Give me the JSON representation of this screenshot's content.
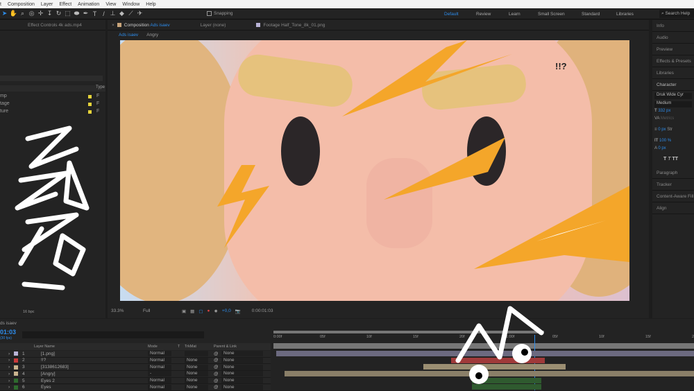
{
  "menu": [
    "t",
    "Composition",
    "Layer",
    "Effect",
    "Animation",
    "View",
    "Window",
    "Help"
  ],
  "toolbar": {
    "snapping": "Snapping"
  },
  "workspaces": [
    "Default",
    "Review",
    "Learn",
    "Small Screen",
    "Standard",
    "Libraries"
  ],
  "search_help": "Search Help",
  "left_panel": {
    "tab": "Effect Controls 4k ads.mp4",
    "type_header": "Type",
    "items": [
      {
        "name": "mp",
        "type": "F"
      },
      {
        "name": "tage",
        "type": "F"
      },
      {
        "name": "ture",
        "type": "F"
      }
    ],
    "bpc": "16 bpc"
  },
  "comp_tabs": {
    "composition": "Composition",
    "comp_name": "Ads isaev",
    "layer": "Layer (none)",
    "footage": "Footage Half_Tone_8k_01.png",
    "breadcrumb": [
      "Ads isaev",
      "Angry"
    ]
  },
  "viewer": {
    "zoom": "33.3%",
    "resolution": "Full",
    "exposure": "+0,0",
    "timecode": "0:00:01:03",
    "overlay_text": "!!?"
  },
  "right_panel": {
    "items": [
      "Info",
      "Audio",
      "Preview",
      "Effects & Presets",
      "Libraries",
      "Character"
    ],
    "font": "Druk Wide Cyr",
    "style": "Medium",
    "size": "332 px",
    "kerning": "Metrics",
    "stroke": "0 px",
    "stroke_label": "Str",
    "vscale": "100 %",
    "baseline": "0 px",
    "lower_items": [
      "Paragraph",
      "Tracker",
      "Content-Aware Fill",
      "Align"
    ]
  },
  "timeline": {
    "comp": "ds isaev",
    "time": "01:03",
    "fps": "(30 fps)",
    "headers": {
      "name": "Layer Name",
      "mode": "Mode",
      "t": "T",
      "trkmat": "TrkMat",
      "parent": "Parent & Link"
    },
    "ruler": [
      "0:00f",
      "05f",
      "10f",
      "15f",
      "20f",
      "1:00f",
      "05f",
      "10f",
      "15f",
      "20f"
    ],
    "layers": [
      {
        "num": "1",
        "color": "#b9b3d6",
        "name": "[1.png]",
        "mode": "Normal",
        "trkmat": "",
        "parent": "None"
      },
      {
        "num": "2",
        "color": "#c83a3a",
        "name": "!!?",
        "mode": "Normal",
        "trkmat": "None",
        "parent": "None"
      },
      {
        "num": "3",
        "color": "#c9b48f",
        "name": "[3138612683]",
        "mode": "Normal",
        "trkmat": "None",
        "parent": "None"
      },
      {
        "num": "4",
        "color": "#c9b48f",
        "name": "[Angry]",
        "mode": "-",
        "trkmat": "None",
        "parent": "None"
      },
      {
        "num": "5",
        "color": "#2e6b2e",
        "name": "Eyes 2",
        "mode": "Normal",
        "trkmat": "None",
        "parent": "None"
      },
      {
        "num": "6",
        "color": "#2e6b2e",
        "name": "Eyes",
        "mode": "Normal",
        "trkmat": "None",
        "parent": "None"
      }
    ]
  },
  "colors": {
    "accent": "#2d8ceb",
    "bolt": "#f4a62a",
    "skin": "#f2b9a6"
  }
}
